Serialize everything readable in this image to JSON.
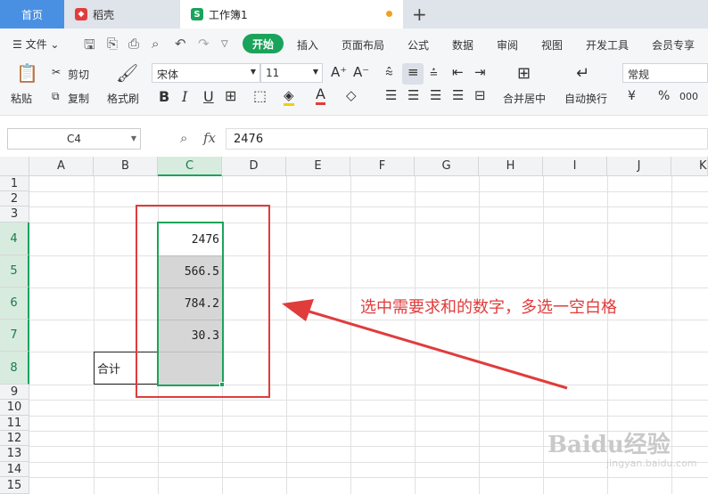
{
  "tabs": {
    "home": "首页",
    "daoke": "稻壳",
    "book": "工作簿1",
    "add": "+"
  },
  "menu": {
    "file": "文件",
    "start": "开始",
    "items": [
      "插入",
      "页面布局",
      "公式",
      "数据",
      "审阅",
      "视图",
      "开发工具",
      "会员专享"
    ]
  },
  "ribbon": {
    "paste": "粘贴",
    "cut": "剪切",
    "copy": "复制",
    "format_painter": "格式刷",
    "font_name": "宋体",
    "font_size": "11",
    "font_grow": "A⁺",
    "font_shrink": "A⁻",
    "bold": "B",
    "italic": "I",
    "underline": "U",
    "merge_center": "合并居中",
    "wrap_text": "自动换行",
    "number_format": "常规",
    "currency": "¥",
    "percent": "%",
    "thousands": "000"
  },
  "formula_bar": {
    "cell_ref": "C4",
    "fx": "fx",
    "value": "2476"
  },
  "grid": {
    "columns": [
      "A",
      "B",
      "C",
      "D",
      "E",
      "F",
      "G",
      "H",
      "I",
      "J",
      "K"
    ],
    "selected_column": "C",
    "rows": [
      "1",
      "2",
      "3",
      "4",
      "5",
      "6",
      "7",
      "8",
      "9",
      "10",
      "11",
      "12",
      "13",
      "14",
      "15"
    ],
    "selected_rows": [
      "4",
      "5",
      "6",
      "7",
      "8"
    ],
    "cells": {
      "C4": "2476",
      "C5": "566.5",
      "C6": "784.2",
      "C7": "30.3",
      "B8": "合计"
    }
  },
  "annotation": {
    "text": "选中需要求和的数字，多选一空白格",
    "color": "#e03c3c"
  },
  "watermark": {
    "brand": "Baidu经验",
    "url": "jingyan.baidu.com"
  },
  "colors": {
    "accent": "#1aa35b",
    "home_tab": "#4a90e2",
    "highlight_fill": "#d6d6d6",
    "annotation": "#e03c3c"
  }
}
